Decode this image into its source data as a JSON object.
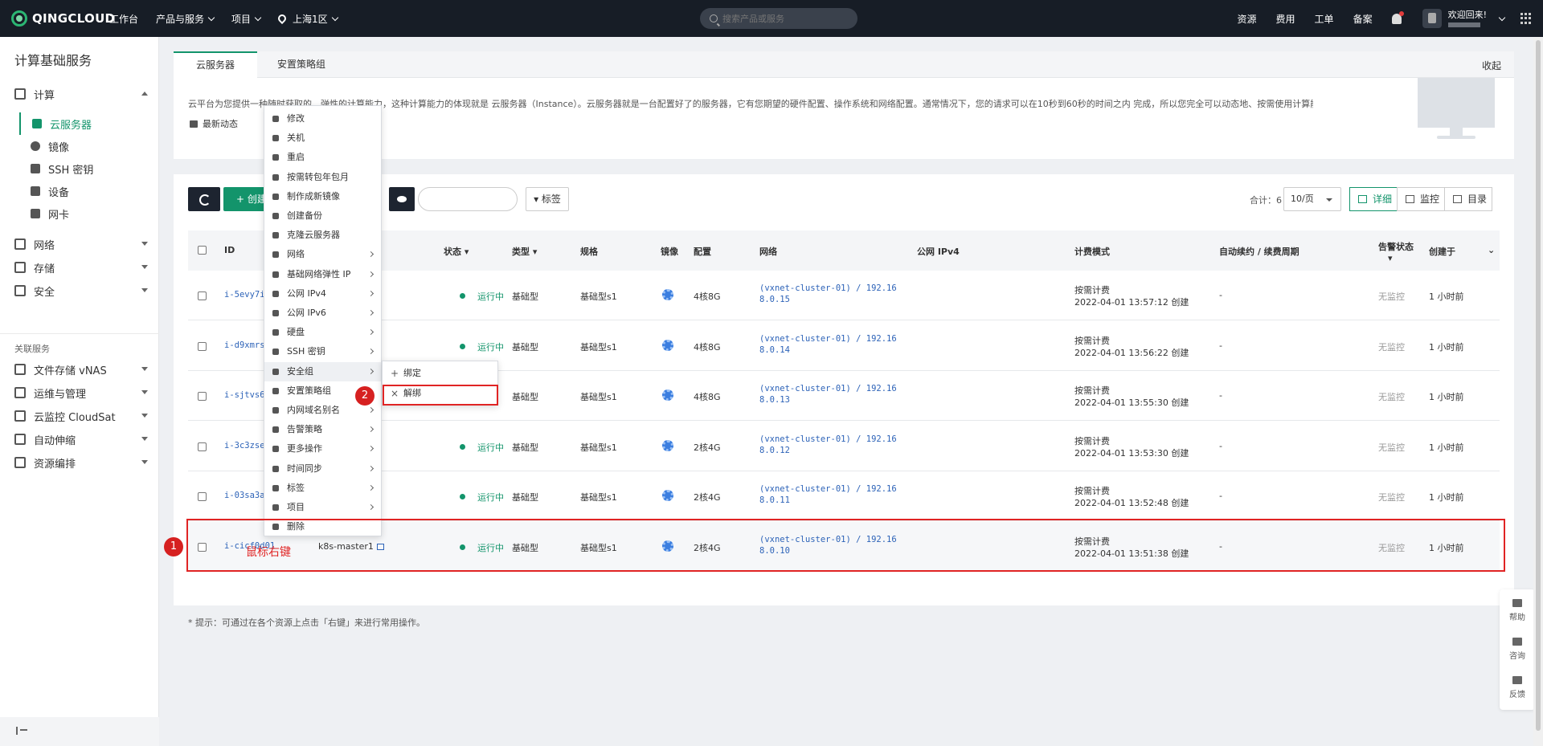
{
  "topbar": {
    "logo": "QINGCLOUD",
    "nav": [
      "工作台",
      "产品与服务",
      "项目"
    ],
    "region": "上海1区",
    "search_placeholder": "搜索产品或服务",
    "right_links": [
      "资源",
      "费用",
      "工单",
      "备案"
    ],
    "welcome": "欢迎回来!"
  },
  "sidebar": {
    "title": "计算基础服务",
    "group_compute": "计算",
    "items": [
      "云服务器",
      "镜像",
      "SSH 密钥",
      "设备",
      "网卡"
    ],
    "groups": [
      "网络",
      "存储",
      "安全"
    ],
    "related_title": "关联服务",
    "related": [
      "文件存储 vNAS",
      "运维与管理",
      "云监控 CloudSat",
      "自动伸缩",
      "资源编排"
    ]
  },
  "tabs": {
    "items": [
      "云服务器",
      "安置策略组"
    ],
    "fold": "收起"
  },
  "intro": {
    "description": "云平台为您提供一种随时获取的、弹性的计算能力，这种计算能力的体现就是 云服务器（Instance）。云服务器就是一台配置好了的服务器，它有您期望的硬件配置、操作系统和网络配置。通常情况下，您的请求可以在10秒到60秒的时间之内 完成，所以您完全可以动态地、按需使用计算能力。",
    "news": "最新动态"
  },
  "toolbar": {
    "create": "+ 创建",
    "tag": "标签",
    "total": "合计：6",
    "page_size": "10/页",
    "views": [
      "详细",
      "监控",
      "目录"
    ]
  },
  "table": {
    "headers": [
      "ID",
      "状态",
      "类型",
      "规格",
      "镜像",
      "配置",
      "网络",
      "公网 IPv4",
      "计费模式",
      "自动续约 / 续费周期",
      "告警状态",
      "创建于"
    ],
    "rows": [
      {
        "id": "i-5evy7i",
        "name": "",
        "status": "运行中",
        "type": "基础型",
        "spec": "基础型s1",
        "config": "4核8G",
        "net1": "(vxnet-cluster-01) / 192.16",
        "net2": "8.0.15",
        "billing": "按需计费",
        "created_at": "2022-04-01 13:57:12 创建",
        "renew": "-",
        "alarm": "无监控",
        "created": "1 小时前"
      },
      {
        "id": "i-d9xmrs",
        "name": "",
        "status": "运行中",
        "type": "基础型",
        "spec": "基础型s1",
        "config": "4核8G",
        "net1": "(vxnet-cluster-01) / 192.16",
        "net2": "8.0.14",
        "billing": "按需计费",
        "created_at": "2022-04-01 13:56:22 创建",
        "renew": "-",
        "alarm": "无监控",
        "created": "1 小时前"
      },
      {
        "id": "i-sjtvs6",
        "name": "",
        "status": "",
        "type": "基础型",
        "spec": "基础型s1",
        "config": "4核8G",
        "net1": "(vxnet-cluster-01) / 192.16",
        "net2": "8.0.13",
        "billing": "按需计费",
        "created_at": "2022-04-01 13:55:30 创建",
        "renew": "-",
        "alarm": "无监控",
        "created": "1 小时前"
      },
      {
        "id": "i-3c3zse",
        "name": "",
        "status": "运行中",
        "type": "基础型",
        "spec": "基础型s1",
        "config": "2核4G",
        "net1": "(vxnet-cluster-01) / 192.16",
        "net2": "8.0.12",
        "billing": "按需计费",
        "created_at": "2022-04-01 13:53:30 创建",
        "renew": "-",
        "alarm": "无监控",
        "created": "1 小时前"
      },
      {
        "id": "i-03sa3a",
        "name": "",
        "status": "运行中",
        "type": "基础型",
        "spec": "基础型s1",
        "config": "2核4G",
        "net1": "(vxnet-cluster-01) / 192.16",
        "net2": "8.0.11",
        "billing": "按需计费",
        "created_at": "2022-04-01 13:52:48 创建",
        "renew": "-",
        "alarm": "无监控",
        "created": "1 小时前"
      },
      {
        "id": "i-cicf0d01",
        "name": "k8s-master1",
        "status": "运行中",
        "type": "基础型",
        "spec": "基础型s1",
        "config": "2核4G",
        "net1": "(vxnet-cluster-01) / 192.16",
        "net2": "8.0.10",
        "billing": "按需计费",
        "created_at": "2022-04-01 13:51:38 创建",
        "renew": "-",
        "alarm": "无监控",
        "created": "1 小时前"
      }
    ],
    "tip": "* 提示：可通过在各个资源上点击「右键」来进行常用操作。"
  },
  "context_menu": {
    "items": [
      "修改",
      "关机",
      "重启",
      "按需转包年包月",
      "制作成新镜像",
      "创建备份",
      "克隆云服务器",
      "网络",
      "基础网络弹性 IP",
      "公网 IPv4",
      "公网 IPv6",
      "硬盘",
      "SSH 密钥",
      "安全组",
      "安置策略组",
      "内网域名别名",
      "告警策略",
      "更多操作",
      "时间同步",
      "标签",
      "项目",
      "删除"
    ],
    "submenu": [
      "绑定",
      "解绑"
    ]
  },
  "annotations": {
    "one": "1",
    "two": "2",
    "right_click": "鼠标右键"
  },
  "float": [
    "帮助",
    "咨询",
    "反馈"
  ],
  "colors": {
    "brand": "#13946b",
    "topbar": "#171d26",
    "annotation": "#e02424"
  }
}
